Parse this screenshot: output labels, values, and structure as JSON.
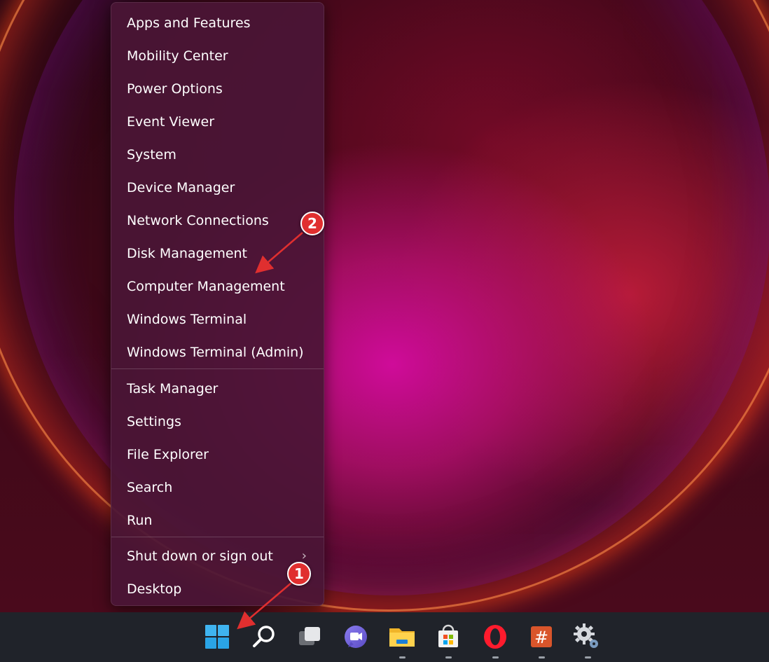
{
  "context_menu": {
    "groups": [
      [
        "Apps and Features",
        "Mobility Center",
        "Power Options",
        "Event Viewer",
        "System",
        "Device Manager",
        "Network Connections",
        "Disk Management",
        "Computer Management",
        "Windows Terminal",
        "Windows Terminal (Admin)"
      ],
      [
        "Task Manager",
        "Settings",
        "File Explorer",
        "Search",
        "Run"
      ],
      [
        "Shut down or sign out",
        "Desktop"
      ]
    ],
    "submenu_item": "Shut down or sign out"
  },
  "annotations": {
    "badge_1": "1",
    "badge_2": "2",
    "color": "#e02f2f"
  },
  "taskbar": {
    "icons": [
      "start-icon",
      "search-icon",
      "task-view-icon",
      "chat-icon",
      "file-explorer-icon",
      "microsoft-store-icon",
      "opera-icon",
      "hash-app-icon",
      "settings-gear-icon"
    ]
  }
}
